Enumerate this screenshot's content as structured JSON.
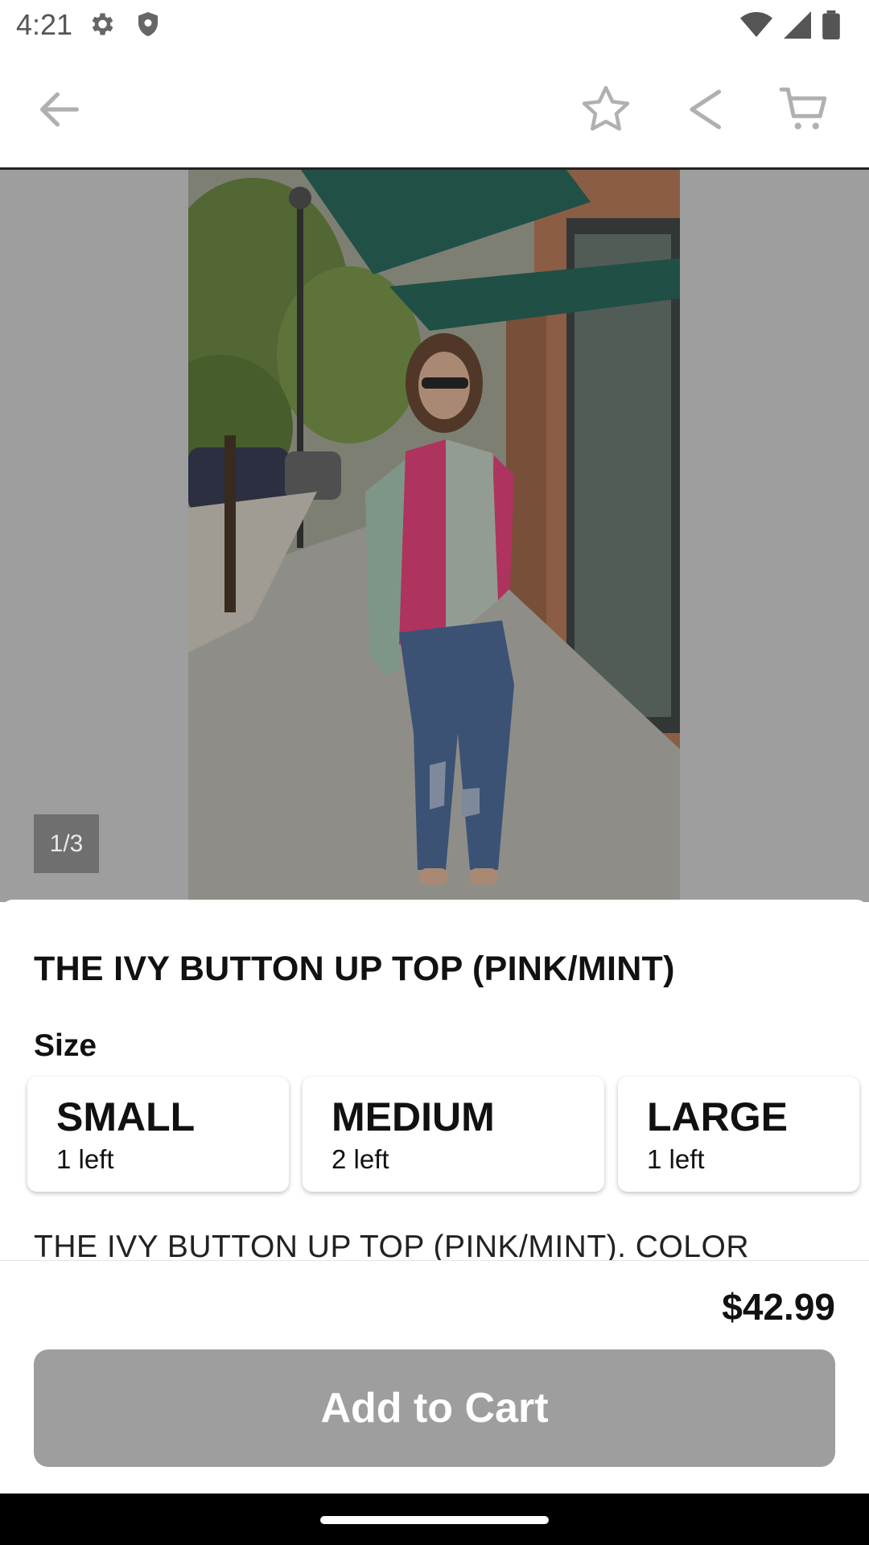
{
  "status_bar": {
    "time": "4:21",
    "icons": [
      "gear-icon",
      "shield-icon",
      "wifi-icon",
      "cell-signal-icon",
      "battery-icon"
    ]
  },
  "app_bar": {
    "icons": [
      "back-arrow-icon",
      "star-icon",
      "share-icon",
      "cart-icon"
    ]
  },
  "gallery": {
    "counter": "1/3"
  },
  "product": {
    "title": "THE IVY BUTTON UP TOP (PINK/MINT)",
    "size_label": "Size",
    "sizes": [
      {
        "name": "SMALL",
        "stock": "1 left"
      },
      {
        "name": "MEDIUM",
        "stock": "2 left"
      },
      {
        "name": "LARGE",
        "stock": "1 left"
      }
    ],
    "description": "THE IVY BUTTON UP TOP (PINK/MINT). COLOR"
  },
  "purchase": {
    "price": "$42.99",
    "add_to_cart": "Add to Cart"
  },
  "colors": {
    "accent_disabled": "#9e9e9e",
    "shirt_pink": "#e8457f",
    "shirt_mint": "#a9c8b5",
    "awning_green": "#2c6b5f"
  }
}
